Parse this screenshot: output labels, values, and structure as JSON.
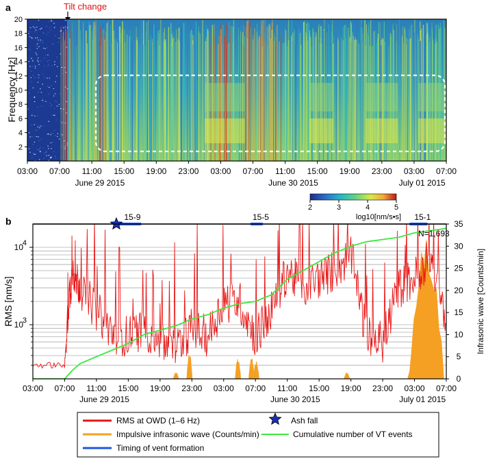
{
  "colors": {
    "rms": "#e81414",
    "infrasound": "#f5a023",
    "vent": "#1f55e0",
    "cumulative": "#3de63d",
    "ash": "#1a2fb8",
    "grid": "#888888",
    "box": "#ffffff"
  },
  "panel_a": {
    "label": "a",
    "annotation": "Tilt change",
    "ylabel": "Frequency [Hz]",
    "yticks": [
      "2",
      "4",
      "6",
      "8",
      "10",
      "12",
      "14",
      "16",
      "18",
      "20"
    ],
    "xticks": [
      "03:00",
      "07:00",
      "11:00",
      "15:00",
      "19:00",
      "23:00",
      "03:00",
      "07:00",
      "11:00",
      "15:00",
      "19:00",
      "23:00",
      "03:00",
      "07:00"
    ],
    "dates": [
      "June 29 2015",
      "June 30 2015",
      "July 01 2015"
    ],
    "colorbar": {
      "ticks": [
        "2",
        "3",
        "4",
        "5"
      ],
      "unit": "log10[nm/s•s]",
      "stops": [
        "#1a2b8c",
        "#2f6fc9",
        "#27b6c8",
        "#5fd18a",
        "#d8e84a",
        "#f0a83a",
        "#c01818"
      ]
    }
  },
  "panel_b": {
    "label": "b",
    "ylabel_left": "RMS [nm/s]",
    "ylabel_right": "Infrasonic wave [Counts/min]",
    "left_ticks": {
      "e3": "10",
      "e3_exp": "3",
      "e4": "10",
      "e4_exp": "4"
    },
    "right_ticks": [
      "0",
      "5",
      "10",
      "15",
      "20",
      "25",
      "30",
      "35"
    ],
    "n_label": "N=1,693",
    "vent_labels": [
      "15-9",
      "15-5",
      "15-1"
    ],
    "xticks": [
      "03:00",
      "07:00",
      "11:00",
      "15:00",
      "19:00",
      "23:00",
      "03:00",
      "07:00",
      "11:00",
      "15:00",
      "19:00",
      "23:00",
      "03:00",
      "07:00"
    ],
    "dates": [
      "June 29 2015",
      "June 30 2015",
      "July 01 2015"
    ]
  },
  "legend": {
    "rms": "RMS at OWD (1–6 Hz)",
    "ash": "Ash fall",
    "infrasound": "Impulsive infrasonic wave (Counts/min)",
    "cumulative": "Cumulative number of VT events",
    "vent": "Timing of vent formation"
  },
  "chart_data": [
    {
      "type": "heatmap",
      "panel": "a",
      "ylabel": "Frequency [Hz]",
      "ylim": [
        0,
        20
      ],
      "xlim": [
        "03:00 June 29 2015",
        "07:00 July 01 2015"
      ],
      "colorbar_range": [
        2,
        5
      ],
      "colorbar_unit": "log10[nm/s•s]",
      "annotations": [
        "Tilt change at ~07:00 June 29 2015"
      ]
    },
    {
      "type": "line",
      "panel": "b",
      "x_hours_from_0300_june29": [
        0,
        4,
        4.5,
        5,
        6,
        8,
        10,
        12,
        14,
        16,
        18,
        20,
        22,
        24,
        26,
        28,
        30,
        32,
        34,
        36,
        38,
        40,
        42,
        44,
        46,
        48,
        50,
        52
      ],
      "series": [
        {
          "name": "RMS at OWD (1–6 Hz)",
          "axis": "left",
          "log": true,
          "unit": "nm/s",
          "values": [
            300,
            300,
            2000,
            5000,
            3000,
            1500,
            800,
            700,
            900,
            600,
            500,
            900,
            700,
            2000,
            2000,
            700,
            1500,
            5000,
            3000,
            4000,
            5000,
            8000,
            700,
            600,
            3000,
            4000,
            8000,
            1000
          ]
        },
        {
          "name": "Cumulative number of VT events",
          "axis": "right",
          "unit": "count (scaled, N=1,693 at end)",
          "values": [
            0,
            0,
            1,
            2,
            3.5,
            5,
            6.5,
            8,
            10,
            11,
            12,
            13.5,
            14.5,
            16,
            17,
            17.5,
            19,
            22.5,
            24.5,
            26.5,
            28.5,
            30,
            31,
            31.5,
            32,
            33,
            33.5,
            34
          ]
        }
      ],
      "bar_series": {
        "name": "Impulsive infrasonic wave (Counts/min)",
        "axis": "right",
        "peaks": [
          {
            "t": 18,
            "value": 1.5
          },
          {
            "t": 19.7,
            "value": 6
          },
          {
            "t": 25.8,
            "value": 5
          },
          {
            "t": 27.5,
            "value": 5
          },
          {
            "t": 28.1,
            "value": 4
          },
          {
            "t": 39.5,
            "value": 1.5
          },
          {
            "t": 47.5,
            "value": 2
          },
          {
            "t": 49.5,
            "value": 32
          }
        ]
      },
      "vent_formation": [
        {
          "label": "15-9",
          "start": 10.5,
          "end": 13.5
        },
        {
          "label": "15-5",
          "start": 27.5,
          "end": 28.8
        },
        {
          "label": "15-1",
          "start": 47.5,
          "end": 49.5
        }
      ],
      "ash_fall": {
        "t": 10.5
      },
      "ylim_left": [
        200,
        20000
      ],
      "ylim_right": [
        0,
        35
      ],
      "n_total": 1693
    }
  ]
}
